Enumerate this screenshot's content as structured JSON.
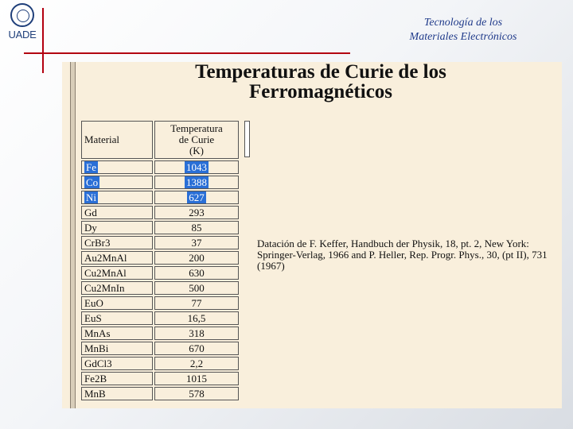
{
  "header": {
    "logo_text": "UADE",
    "title_line1": "Tecnología de los",
    "title_line2": "Materiales Electrónicos"
  },
  "slide": {
    "title_line1": "Temperaturas de Curie de los",
    "title_line2": "Ferromagnéticos",
    "table": {
      "col_material": "Material",
      "col_temp_line1": "Temperatura",
      "col_temp_line2": "de Curie",
      "col_temp_line3": "(K)",
      "rows": [
        {
          "material": "Fe",
          "temp": "1043"
        },
        {
          "material": "Co",
          "temp": "1388"
        },
        {
          "material": "Ni",
          "temp": "627"
        },
        {
          "material": "Gd",
          "temp": "293"
        },
        {
          "material": "Dy",
          "temp": "85"
        },
        {
          "material": "CrBr3",
          "temp": "37"
        },
        {
          "material": "Au2MnAl",
          "temp": "200"
        },
        {
          "material": "Cu2MnAl",
          "temp": "630"
        },
        {
          "material": "Cu2MnIn",
          "temp": "500"
        },
        {
          "material": "EuO",
          "temp": "77"
        },
        {
          "material": "EuS",
          "temp": "16,5"
        },
        {
          "material": "MnAs",
          "temp": "318"
        },
        {
          "material": "MnBi",
          "temp": "670"
        },
        {
          "material": "GdCl3",
          "temp": "2,2"
        },
        {
          "material": "Fe2B",
          "temp": "1015"
        },
        {
          "material": "MnB",
          "temp": "578"
        }
      ]
    },
    "reference": "Datación de F. Keffer, Handbuch der Physik, 18, pt. 2, New York: Springer-Verlag, 1966 and P. Heller, Rep. Progr. Phys., 30, (pt II), 731 (1967)"
  },
  "colors": {
    "accent_red": "#b30010",
    "header_blue": "#1f3a8a",
    "panel_bg": "#f9efdc",
    "selection": "#2a6fd6"
  }
}
